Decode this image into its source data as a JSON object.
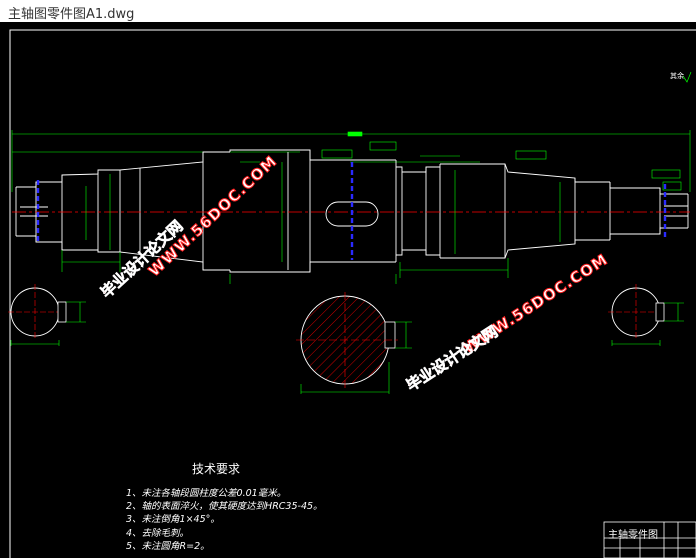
{
  "window": {
    "title": "主轴图零件图A1.dwg"
  },
  "drawing": {
    "top_note": "其余",
    "tech_requirements": {
      "title": "技术要求",
      "items": [
        "1、未注各轴段圆柱度公差0.01毫米。",
        "2、轴的表面淬火，使其硬度达到HRC35-45。",
        "3、未注倒角1×45°。",
        "4、去除毛刺。",
        "5、未注圆角R=2。"
      ]
    },
    "title_block": {
      "part_name": "主轴零件图"
    }
  },
  "watermarks": {
    "url": "WWW.56DOC.COM",
    "cn": "毕业设计论文网"
  },
  "colors": {
    "background": "#000000",
    "outline": "#ffffff",
    "dimension": "#00ff00",
    "centerline": "#ff0000",
    "hatch": "#ff0000",
    "keyway_marks": "#0000ff",
    "watermark_red": "#ff1e1e"
  }
}
